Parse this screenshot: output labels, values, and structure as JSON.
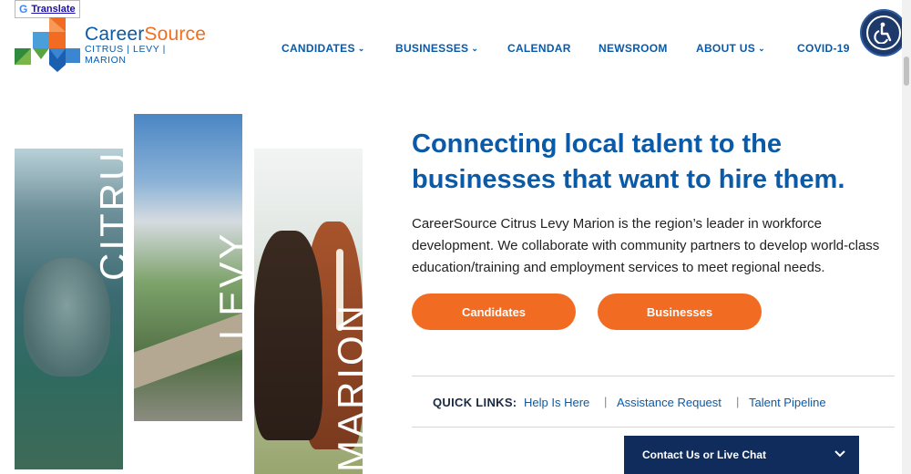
{
  "translate": {
    "g": "G",
    "label": "Translate"
  },
  "logo": {
    "brand_career": "Career",
    "brand_source": "Source",
    "subtitle": "CITRUS | LEVY | MARION"
  },
  "nav": [
    {
      "label": "CANDIDATES",
      "dropdown": true
    },
    {
      "label": "BUSINESSES",
      "dropdown": true
    },
    {
      "label": "CALENDAR",
      "dropdown": false
    },
    {
      "label": "NEWSROOM",
      "dropdown": false
    },
    {
      "label": "ABOUT US",
      "dropdown": true
    },
    {
      "label": "COVID-19",
      "dropdown": false
    }
  ],
  "accessibility": {
    "icon": "wheelchair-icon"
  },
  "hero": {
    "panels": [
      "CITRUS",
      "LEVY",
      "MARION"
    ],
    "headline": "Connecting local talent to the businesses that want to hire them.",
    "description": "CareerSource Citrus Levy Marion is the region’s leader in workforce development. We collaborate with community partners to develop world-class education/training and employment services to meet regional needs.",
    "button_candidates": "Candidates",
    "button_businesses": "Businesses"
  },
  "quick_links": {
    "label": "QUICK LINKS:",
    "links": [
      "Help Is Here",
      "Assistance Request",
      "Talent Pipeline"
    ]
  },
  "chat": {
    "label": "Contact Us or Live Chat"
  },
  "colors": {
    "brand_blue": "#0a5aa8",
    "brand_orange": "#f26b22",
    "navy": "#0f2c5c"
  }
}
